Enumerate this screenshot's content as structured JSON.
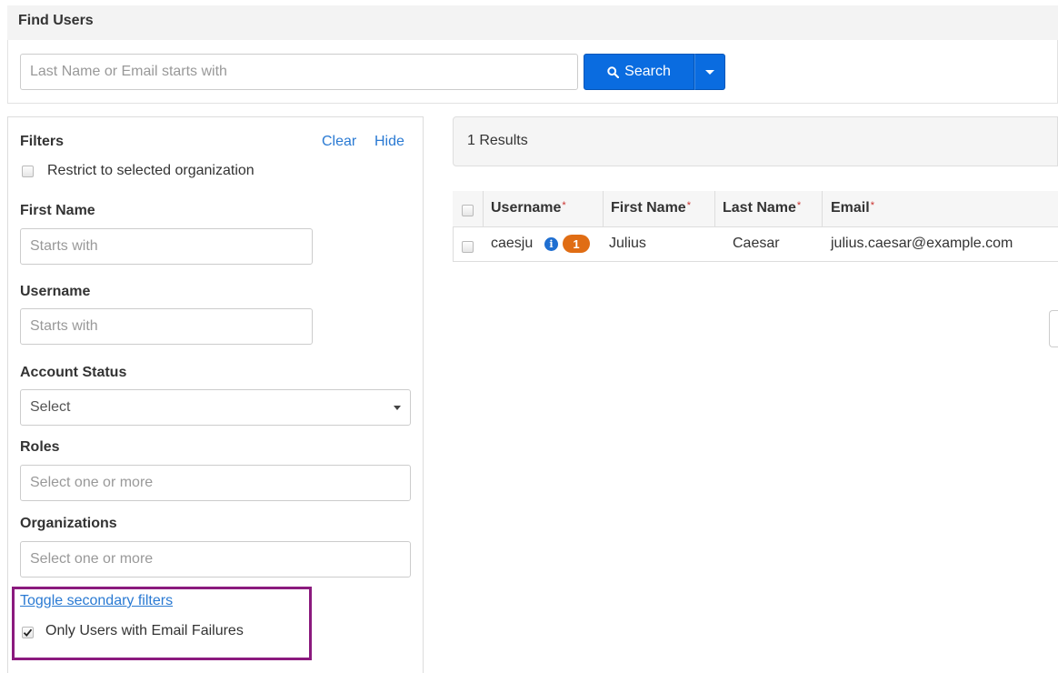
{
  "header": {
    "title": "Find Users"
  },
  "search": {
    "placeholder": "Last Name or Email starts with",
    "button_label": "Search",
    "accent_color": "#0a6ce0"
  },
  "filters": {
    "title": "Filters",
    "clear_label": "Clear",
    "hide_label": "Hide",
    "restrict_label": "Restrict to selected organization",
    "restrict_checked": false,
    "first_name": {
      "label": "First Name",
      "placeholder": "Starts with"
    },
    "username": {
      "label": "Username",
      "placeholder": "Starts with"
    },
    "account_status": {
      "label": "Account Status",
      "selected": "Select"
    },
    "roles": {
      "label": "Roles",
      "placeholder": "Select one or more"
    },
    "organizations": {
      "label": "Organizations",
      "placeholder": "Select one or more"
    },
    "toggle_secondary_label": "Toggle secondary filters",
    "email_failures": {
      "label": "Only Users with Email Failures",
      "checked": true
    }
  },
  "results": {
    "summary": "1 Results",
    "columns": [
      "Username",
      "First Name",
      "Last Name",
      "Email"
    ],
    "required_marker": "*",
    "rows": [
      {
        "username": "caesju",
        "info_icon": "info-icon",
        "badge": "1",
        "first_name": "Julius",
        "last_name": "Caesar",
        "email": "julius.caesar@example.com"
      }
    ]
  },
  "colors": {
    "badge": "#e06d14",
    "highlight_border": "#8b1a7e",
    "link": "#2a7ad3"
  }
}
